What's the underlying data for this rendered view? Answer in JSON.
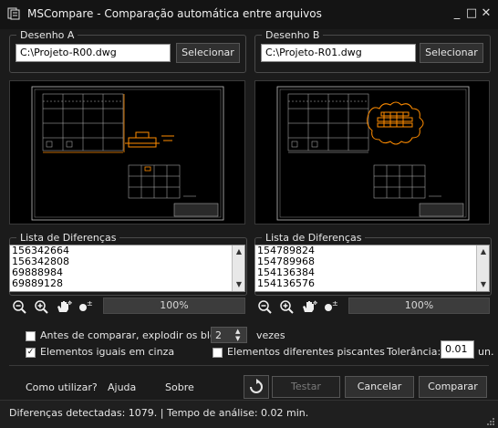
{
  "window": {
    "title": "MSCompare - Comparação automática entre arquivos",
    "controls": [
      "_",
      "□",
      "✕"
    ]
  },
  "panelA": {
    "legend": "Desenho A",
    "path": "C:\\Projeto-R00.dwg",
    "select_label": "Selecionar",
    "list_legend": "Lista de Diferenças",
    "items": [
      "156342664",
      "156342808",
      "69888984",
      "69889128"
    ],
    "progress": "100%"
  },
  "panelB": {
    "legend": "Desenho B",
    "path": "C:\\Projeto-R01.dwg",
    "select_label": "Selecionar",
    "list_legend": "Lista de Diferenças",
    "items": [
      "154789824",
      "154789968",
      "154136384",
      "154136576"
    ],
    "progress": "100%"
  },
  "options": {
    "explode_label": "Antes de comparar, explodir os blocos",
    "explode_checked": false,
    "explode_levels": "2",
    "levels_unit": "vezes",
    "gray_label": "Elementos iguais em cinza",
    "gray_checked": true,
    "blink_label": "Elementos diferentes piscantes",
    "blink_checked": false,
    "tolerance_label": "Tolerância:",
    "tolerance_value": "0.01",
    "tolerance_unit": "un."
  },
  "footer": {
    "help_link": "Como utilizar?",
    "ajuda_link": "Ajuda",
    "about_link": "Sobre",
    "test_label": "Testar",
    "cancel_label": "Cancelar",
    "compare_label": "Comparar"
  },
  "status": {
    "text": "Diferenças detectadas: 1079. | Tempo de análise: 0.02 min."
  },
  "colors": {
    "background": "#1b1b1b",
    "highlight": "#ff8c00",
    "drawing_lines": "#bdbdbd"
  },
  "icons": [
    "zoom-out-icon",
    "zoom-in-icon",
    "pan-hand-icon",
    "zoom-extents-icon",
    "refresh-icon",
    "app-icon"
  ]
}
